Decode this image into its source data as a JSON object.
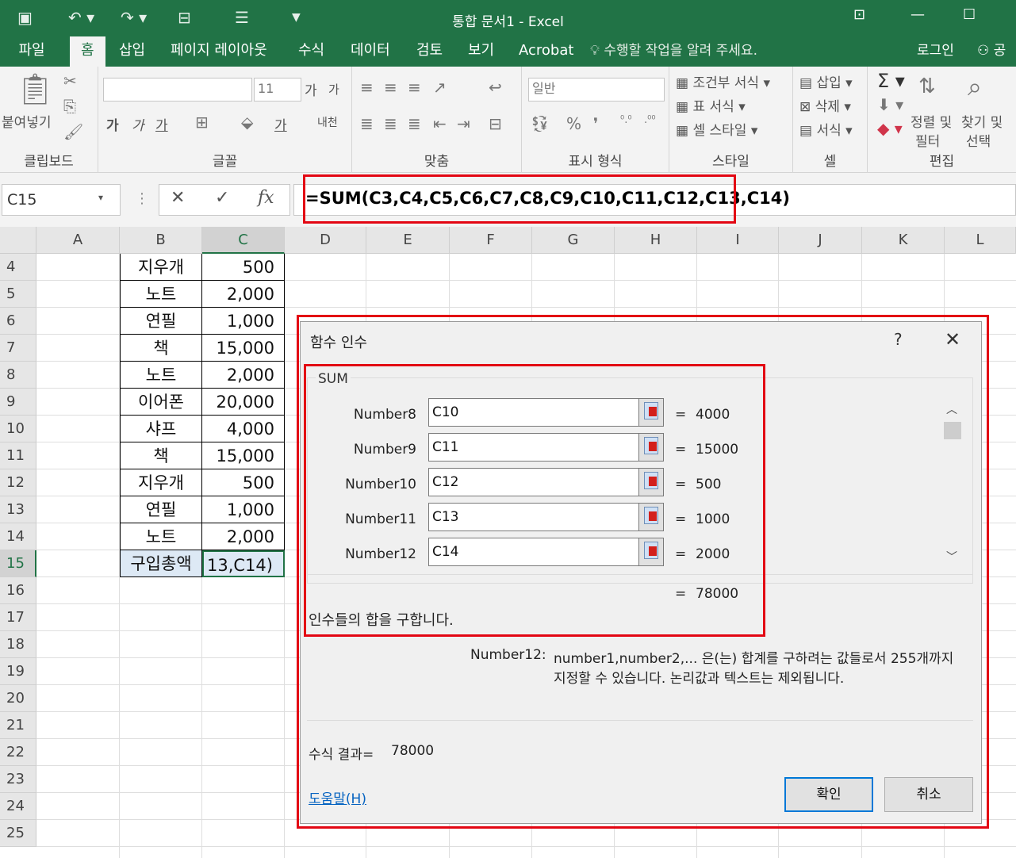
{
  "window": {
    "title": "통합 문서1 - Excel"
  },
  "ribbon_tabs": {
    "file": "파일",
    "home": "홈",
    "insert": "삽입",
    "page_layout": "페이지 레이아웃",
    "formulas": "수식",
    "data": "데이터",
    "review": "검토",
    "view": "보기",
    "acrobat": "Acrobat",
    "tell_me": "수행할 작업을 알려 주세요.",
    "login": "로그인",
    "share": "공"
  },
  "ribbon": {
    "clipboard": {
      "label": "클립보드",
      "paste": "붙여넣기"
    },
    "font": {
      "label": "글꼴",
      "size": "11",
      "bold": "가",
      "italic": "가",
      "underline": "가",
      "grow": "가",
      "shrink": "가",
      "color": "가",
      "phonetic": "내천"
    },
    "alignment": {
      "label": "맞춤"
    },
    "number": {
      "label": "표시 형식",
      "format": "일반"
    },
    "styles": {
      "label": "스타일",
      "conditional": "조건부 서식",
      "table": "표 서식",
      "cell": "셀 스타일"
    },
    "cells": {
      "label": "셀",
      "insert": "삽입",
      "delete": "삭제",
      "format": "서식"
    },
    "editing": {
      "label": "편집",
      "sort_filter_1": "정렬 및",
      "sort_filter_2": "필터",
      "find_select_1": "찾기 및",
      "find_select_2": "선택"
    }
  },
  "formula_bar": {
    "name_box": "C15",
    "formula": "=SUM(C3,C4,C5,C6,C7,C8,C9,C10,C11,C12,C13,C14)",
    "fx": "fx"
  },
  "columns": [
    "A",
    "B",
    "C",
    "D",
    "E",
    "F",
    "G",
    "H",
    "I",
    "J",
    "K",
    "L"
  ],
  "rows": [
    "4",
    "5",
    "6",
    "7",
    "8",
    "9",
    "10",
    "11",
    "12",
    "13",
    "14",
    "15",
    "16",
    "17",
    "18",
    "19",
    "20",
    "21",
    "22",
    "23",
    "24",
    "25"
  ],
  "table": [
    {
      "item": "지우개",
      "price": "500"
    },
    {
      "item": "노트",
      "price": "2,000"
    },
    {
      "item": "연필",
      "price": "1,000"
    },
    {
      "item": "책",
      "price": "15,000"
    },
    {
      "item": "노트",
      "price": "2,000"
    },
    {
      "item": "이어폰",
      "price": "20,000"
    },
    {
      "item": "샤프",
      "price": "4,000"
    },
    {
      "item": "책",
      "price": "15,000"
    },
    {
      "item": "지우개",
      "price": "500"
    },
    {
      "item": "연필",
      "price": "1,000"
    },
    {
      "item": "노트",
      "price": "2,000"
    },
    {
      "item": "구입총액",
      "price": "13,C14)"
    }
  ],
  "dialog": {
    "title": "함수 인수",
    "help_icon": "?",
    "function_name": "SUM",
    "args": [
      {
        "label": "Number8",
        "ref": "C10",
        "value": "4000"
      },
      {
        "label": "Number9",
        "ref": "C11",
        "value": "15000"
      },
      {
        "label": "Number10",
        "ref": "C12",
        "value": "500"
      },
      {
        "label": "Number11",
        "ref": "C13",
        "value": "1000"
      },
      {
        "label": "Number12",
        "ref": "C14",
        "value": "2000"
      }
    ],
    "equals": "=",
    "total": "78000",
    "function_description": "인수들의 합을 구합니다.",
    "arg_name": "Number12:",
    "arg_description_1": "number1,number2,... 은(는) 합계를 구하려는 값들로서 255개까지",
    "arg_description_2": "지정할 수 있습니다. 논리값과 텍스트는 제외됩니다.",
    "result_label": "수식 결과=",
    "result_value": "78000",
    "help_link": "도움말(H)",
    "ok": "확인",
    "cancel": "취소"
  },
  "colors": {
    "excel_green": "#217346",
    "highlight_red": "#e30613",
    "link_blue": "#0563c1"
  }
}
